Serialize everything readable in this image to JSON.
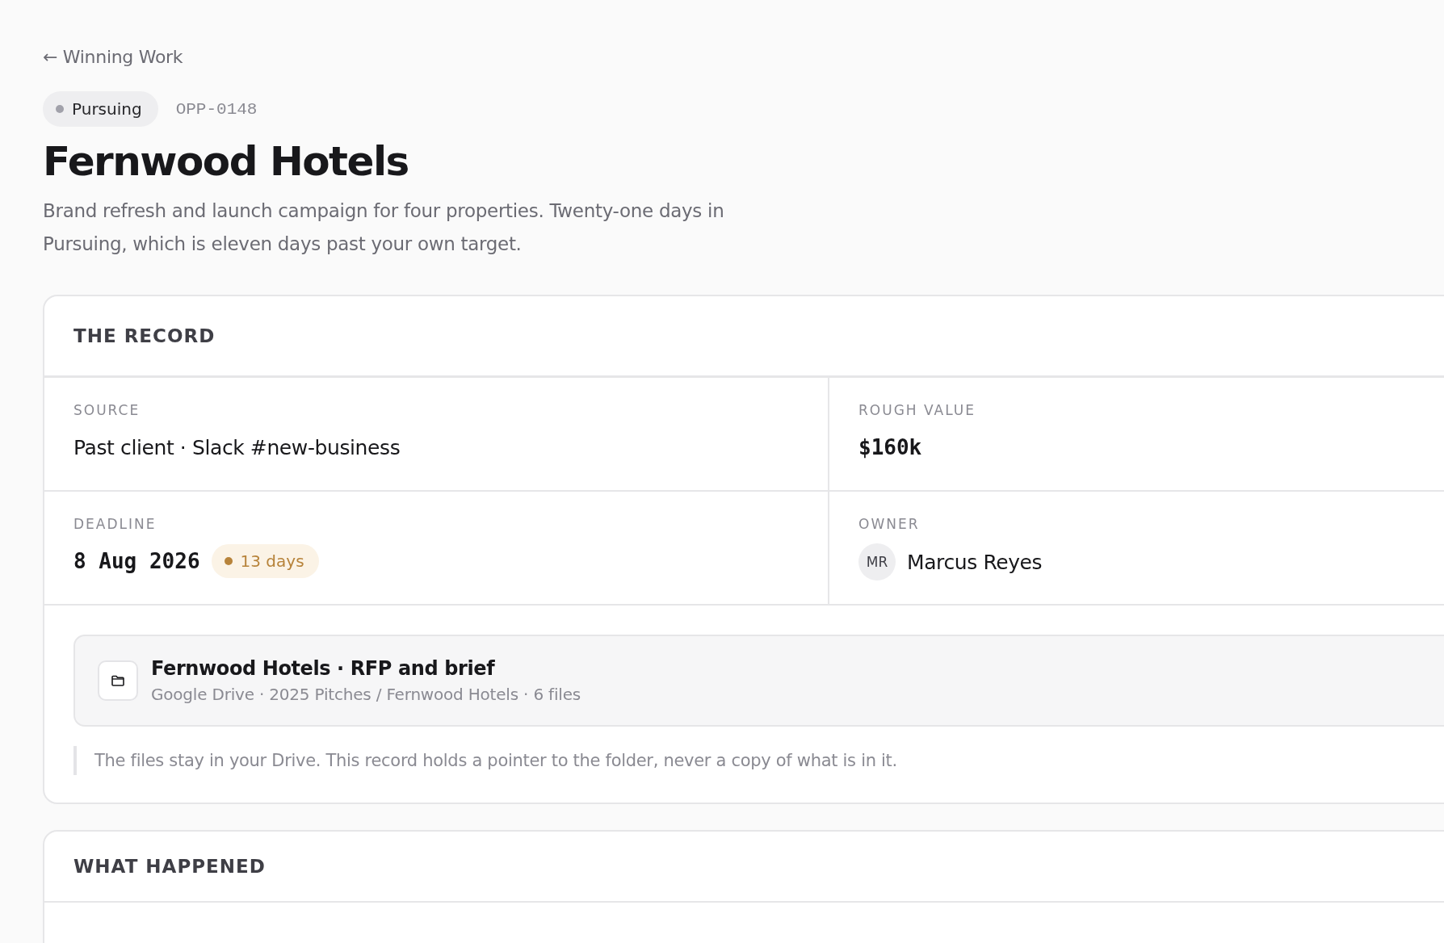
{
  "back_link": {
    "arrow": "←",
    "label": "Winning Work"
  },
  "status": {
    "label": "Pursuing",
    "color": "#a1a1aa"
  },
  "record_id": "OPP-0148",
  "title": "Fernwood Hotels",
  "summary": "Brand refresh and launch campaign for four properties. Twenty-one days in Pursuing, which is eleven days past your own target.",
  "record": {
    "heading": "THE RECORD",
    "fields": [
      {
        "kind": "text",
        "label": "SOURCE",
        "value": "Past client · Slack #new-business"
      },
      {
        "kind": "mono",
        "label": "ROUGH VALUE",
        "value": "$160k"
      },
      {
        "kind": "date",
        "label": "DEADLINE",
        "value": "8 Aug 2026",
        "badge": {
          "label": "13 days",
          "color": "#b7833a"
        }
      },
      {
        "kind": "person",
        "label": "OWNER",
        "initials": "MR",
        "value": "Marcus Reyes"
      }
    ],
    "folder": {
      "name": "Fernwood Hotels · RFP and brief",
      "path": "Google Drive · 2025 Pitches / Fernwood Hotels · 6 files"
    },
    "note": "The files stay in your Drive. This record holds a pointer to the folder, never a copy of what is in it."
  },
  "history": {
    "heading": "WHAT HAPPENED"
  }
}
